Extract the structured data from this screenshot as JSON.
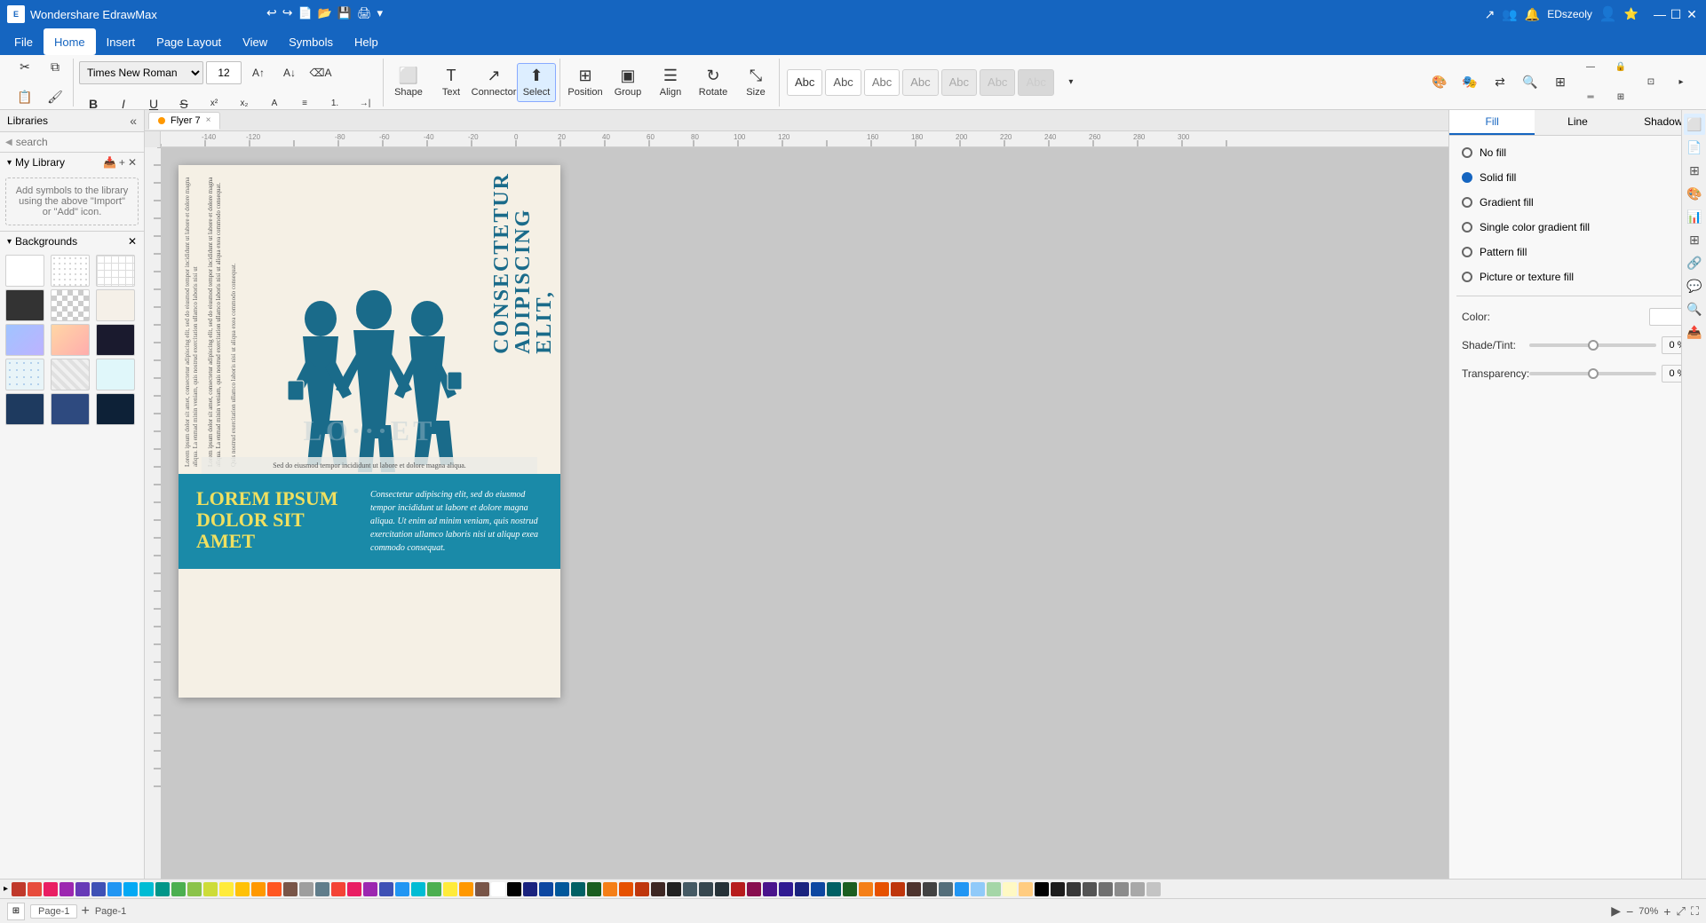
{
  "app": {
    "title": "Wondershare EdrawMax",
    "user": "EDszeoly"
  },
  "titlebar": {
    "undo_label": "↩",
    "redo_label": "↪",
    "window_controls": [
      "—",
      "☐",
      "✕"
    ]
  },
  "menubar": {
    "items": [
      "File",
      "Home",
      "Insert",
      "Page Layout",
      "View",
      "Symbols",
      "Help"
    ]
  },
  "toolbar": {
    "font_name": "Times New Roman",
    "font_size": "12",
    "shape_label": "Shape",
    "text_label": "Text",
    "connector_label": "Connector",
    "select_label": "Select",
    "position_label": "Position",
    "group_label": "Group",
    "align_label": "Align",
    "rotate_label": "Rotate",
    "size_label": "Size"
  },
  "left_panel": {
    "libraries_label": "Libraries",
    "search_placeholder": "search",
    "my_library_label": "My Library",
    "my_library_hint": "Add symbols to the library using the above \"Import\" or \"Add\" icon.",
    "backgrounds_label": "Backgrounds"
  },
  "doc_tab": {
    "name": "Flyer 7",
    "close": "×"
  },
  "canvas": {
    "flyer": {
      "big_title": "CONSECTETUR ADIPISCING ELIT,",
      "vertical_texts": [
        "Lorem ipsum dolor sit amet, consectetur adipiscing elit, sed do eiusmod tempor incididunt ut labore et dolore magna aliqua. Ut enim ad minim veniam, quis nostrud exercitation ullamco laboris nisi ut",
        "Lorem ipsum dolor sit amet, consectetur adipiscing elit, sed do eiusmod tempor incididunt ut labore et dolore magna aliqua. La enmad minin veniam, quis nostrud exercitation ullamco laboris nisi ut aliqua exea commodo consequat.",
        "Quis nostrud exercitation ullamco laboris nisi ut aliqua exea commodo consequat."
      ],
      "subtitle": "LO...ET",
      "caption": "Sed do eiusmod tempor incididunt ut labore et dolore magna aliqua.",
      "lorem_title": "LOREM IPSUM\nDOLOR SIT\nAMET",
      "lorem_body": "Consectetur adipiscing elit, sed do eiusmod tempor incididunt ut labore et dolore magna aliqua. Ut enim ad minim veniam, quis nostrud exercitation ullamco laboris nisi ut aliqup exea commodo consequat."
    }
  },
  "right_panel": {
    "tabs": [
      "Fill",
      "Line",
      "Shadow"
    ],
    "active_tab": "Fill",
    "fill_options": [
      {
        "id": "no-fill",
        "label": "No fill",
        "selected": false
      },
      {
        "id": "solid-fill",
        "label": "Solid fill",
        "selected": true
      },
      {
        "id": "gradient-fill",
        "label": "Gradient fill",
        "selected": false
      },
      {
        "id": "single-color-gradient",
        "label": "Single color gradient fill",
        "selected": false
      },
      {
        "id": "pattern-fill",
        "label": "Pattern fill",
        "selected": false
      },
      {
        "id": "picture-texture",
        "label": "Picture or texture fill",
        "selected": false
      }
    ],
    "color_label": "Color:",
    "shade_tint_label": "Shade/Tint:",
    "shade_value": "0 %",
    "transparency_label": "Transparency:",
    "transparency_value": "0 %"
  },
  "status_bar": {
    "page_label": "Page-1",
    "page_tab": "Page-1",
    "add_page": "+",
    "zoom_level": "70%",
    "fit_label": "Fit"
  },
  "palette_colors": [
    "#c0392b",
    "#e74c3c",
    "#e91e63",
    "#9c27b0",
    "#673ab7",
    "#3f51b5",
    "#2196f3",
    "#03a9f4",
    "#00bcd4",
    "#009688",
    "#4caf50",
    "#8bc34a",
    "#cddc39",
    "#ffeb3b",
    "#ffc107",
    "#ff9800",
    "#ff5722",
    "#795548",
    "#9e9e9e",
    "#607d8b",
    "#f44336",
    "#e91e63",
    "#9c27b0",
    "#3f51b5",
    "#2196f3",
    "#00bcd4",
    "#4caf50",
    "#ffeb3b",
    "#ff9800",
    "#795548",
    "#ffffff",
    "#000000",
    "#1a237e",
    "#0d47a1",
    "#01579b",
    "#006064",
    "#1b5e20",
    "#f57f17",
    "#e65100",
    "#bf360c",
    "#3e2723",
    "#212121",
    "#455a64",
    "#37474f",
    "#263238",
    "#b71c1c",
    "#880e4f",
    "#4a148c",
    "#311b92",
    "#1a237e",
    "#0d47a1",
    "#006064",
    "#1b5e20",
    "#f57f17",
    "#e65100",
    "#bf360c",
    "#4e342e",
    "#424242",
    "#546e7a",
    "#2196f3",
    "#90caf9",
    "#a5d6a7",
    "#fff9c4",
    "#ffcc80",
    "#000000",
    "#1c1c1c",
    "#383838",
    "#545454",
    "#707070",
    "#8c8c8c",
    "#a8a8a8",
    "#c4c4c4"
  ],
  "abc_styles": [
    {
      "label": "Abc",
      "color": "#333"
    },
    {
      "label": "Abc",
      "color": "#555"
    },
    {
      "label": "Abc",
      "color": "#777"
    },
    {
      "label": "Abc",
      "color": "#999"
    },
    {
      "label": "Abc",
      "color": "#aaa"
    },
    {
      "label": "Abc",
      "color": "#bbb"
    },
    {
      "label": "Abc",
      "color": "#ccc"
    }
  ]
}
